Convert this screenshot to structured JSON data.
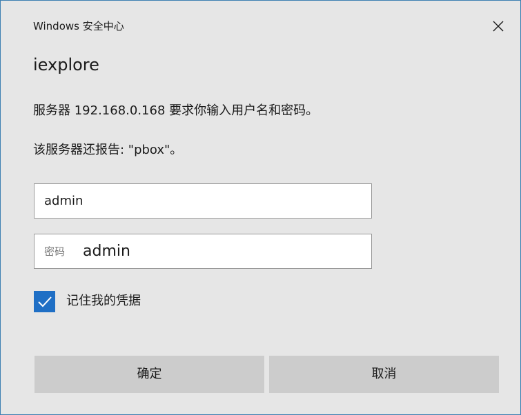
{
  "window": {
    "title": "Windows 安全中心",
    "close_icon": "close-icon"
  },
  "app_name": "iexplore",
  "messages": {
    "line1": "服务器 192.168.0.168 要求你输入用户名和密码。",
    "line2": "该服务器还报告: \"pbox\"。"
  },
  "username_field": {
    "value": "admin"
  },
  "password_field": {
    "placeholder": "密码",
    "typed_text": "admin"
  },
  "remember": {
    "label": "记住我的凭据",
    "checked": true,
    "icon": "checkmark-icon"
  },
  "buttons": {
    "ok_label": "确定",
    "cancel_label": "取消"
  },
  "colors": {
    "accent": "#1f6fc5",
    "window_border": "#3c7fb1",
    "dialog_background": "#e6e6e6",
    "button_background": "#cccccc"
  }
}
